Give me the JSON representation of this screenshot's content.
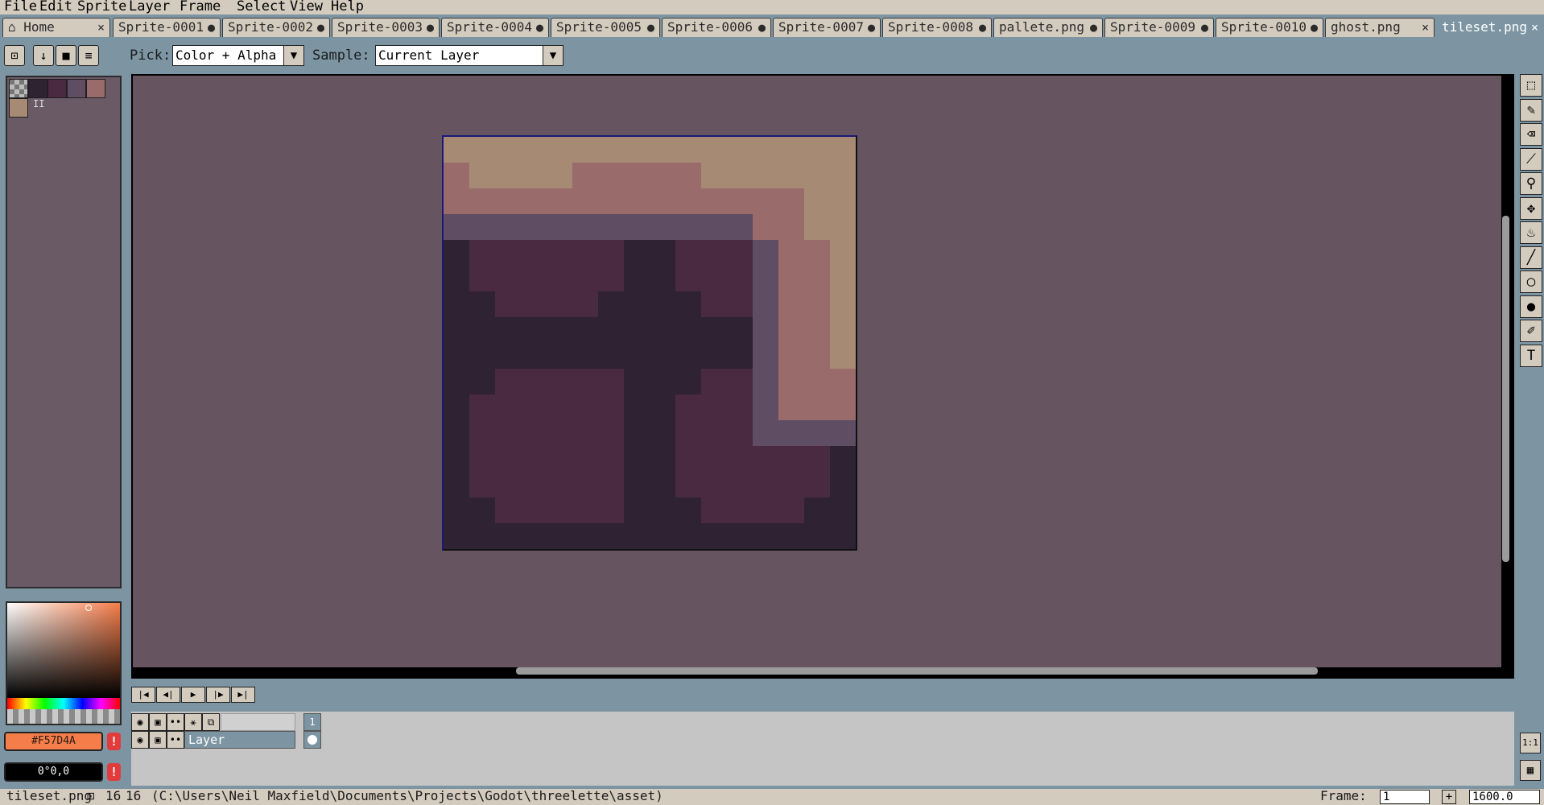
{
  "menu": [
    "File",
    "Edit",
    "Sprite",
    "Layer",
    "Frame",
    "Select",
    "View",
    "Help"
  ],
  "tabs": [
    {
      "label": "Home",
      "mark": "×",
      "home": true
    },
    {
      "label": "Sprite-0001",
      "mark": "●"
    },
    {
      "label": "Sprite-0002",
      "mark": "●"
    },
    {
      "label": "Sprite-0003",
      "mark": "●"
    },
    {
      "label": "Sprite-0004",
      "mark": "●"
    },
    {
      "label": "Sprite-0005",
      "mark": "●"
    },
    {
      "label": "Sprite-0006",
      "mark": "●"
    },
    {
      "label": "Sprite-0007",
      "mark": "●"
    },
    {
      "label": "Sprite-0008",
      "mark": "●"
    },
    {
      "label": "pallete.png",
      "mark": "●"
    },
    {
      "label": "Sprite-0009",
      "mark": "●"
    },
    {
      "label": "Sprite-0010",
      "mark": "●"
    },
    {
      "label": "ghost.png",
      "mark": "×"
    },
    {
      "label": "tileset.png",
      "mark": "×",
      "active": true
    }
  ],
  "toolbar": {
    "pick_label": "Pick:",
    "pick_value": "Color + Alpha",
    "sample_label": "Sample:",
    "sample_value": "Current Layer"
  },
  "palette": {
    "colors": [
      "#2e2233",
      "#4a2a40",
      "#5f4d63",
      "#9a6b6b",
      "#a68a73"
    ],
    "index_label": "II"
  },
  "colors": {
    "foreground": "#F57D4A",
    "foreground_hex": "#f57d4a",
    "background": "0°0,0",
    "canvas_bg": "#665561",
    "ui_bg": "#7d95a3",
    "panel": "#d3cbbe",
    "warning": "#e23b3b"
  },
  "sprite": {
    "width": 16,
    "height": 16,
    "pixels": [
      "TTTTTTTTTTTTTTTT",
      "PTTTTPPPPPTTTTTT",
      "PPPPPPPPPPPPPPTT",
      "GGGGGGGGGGGGPPTT",
      "DMMMMMMDDMMMGPPT",
      "DMMMMMMDDMMMGPPT",
      "DDMMMMDDDDMMGPPT",
      "DDDDDDDDDDDDGPPT",
      "DDDDDDDDDDDDGPPT",
      "DDMMMMMDDDMMGPPP",
      "DMMMMMMDDMMMGPPP",
      "DMMMMMMDDMMMGGGG",
      "DMMMMMMDDMMMMMMD",
      "DMMMMMMDDMMMMMMD",
      "DDMMMMMDDDMMMMDD",
      "DDDDDDDDDDDDDDDD"
    ],
    "legend": {
      "T": "#a68a73",
      "P": "#9a6b6b",
      "G": "#5f4d63",
      "M": "#4a2a40",
      "D": "#2e2233"
    }
  },
  "tools": [
    "rectangular-marquee-icon",
    "pencil-icon",
    "eraser-icon",
    "eyedropper-icon",
    "zoom-icon",
    "move-icon",
    "paint-bucket-icon",
    "line-icon",
    "ellipse-icon",
    "contour-icon",
    "blur-icon",
    "text-icon"
  ],
  "timeline": {
    "frame_number": "1",
    "layer_name": "Layer"
  },
  "status": {
    "filename": "tileset.png",
    "width": "16",
    "height": "16",
    "path": "(C:\\Users\\Neil Maxfield\\Documents\\Projects\\Godot\\threelette\\asset)",
    "frame_label": "Frame:",
    "frame_value": "1",
    "zoom": "1600.0"
  },
  "side_buttons": [
    "1:1",
    "▦"
  ]
}
